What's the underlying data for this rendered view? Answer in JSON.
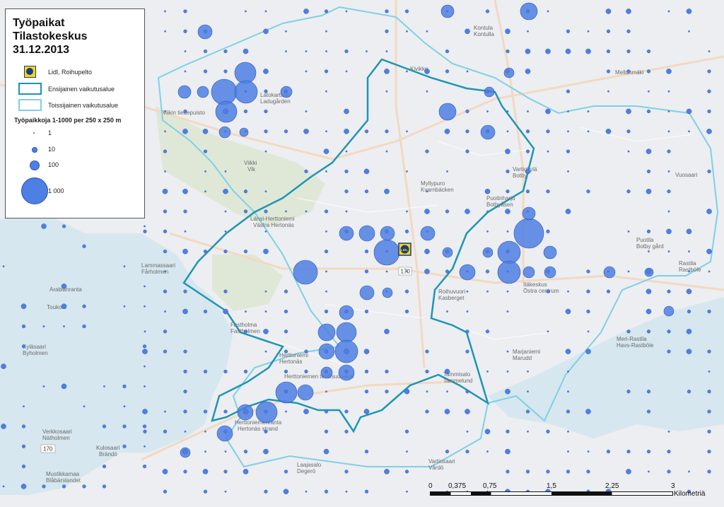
{
  "legend": {
    "title": "Työpaikat\nTilastokeskus\n31.12.2013",
    "store_label": "Lidl, Roihupelto",
    "primary_area_label": "Ensijainen vaikutusalue",
    "secondary_area_label": "Toissijainen vaikutusalue",
    "size_heading": "Työpaikkoja 1-1000 per 250 x 250 m",
    "size_classes": [
      "1",
      "10",
      "100",
      "1 000"
    ],
    "store_icon_text": "LIDL"
  },
  "scale_bar": {
    "ticks": [
      "0",
      "0,375",
      "0,75",
      "1,5",
      "2,25",
      "3"
    ],
    "unit": "Kilometriä"
  },
  "place_names": [
    "Kontula",
    "Kontulla",
    "Kivikko",
    "Mellunmäki",
    "Myllypuro",
    "Kvarnbäcken",
    "Latokartano",
    "Ladugården",
    "Viikki",
    "Vik",
    "Viikin tiedepuisto",
    "Länsi-Herttoniemi",
    "Västra Hertonäs",
    "Puotinharju",
    "Botbyåsen",
    "Puotila",
    "Botby gård",
    "Rastila",
    "Rastböle",
    "Vuosaari",
    "Itäkeskus",
    "Östra centrum",
    "Roihuvuori",
    "Kasberget",
    "Fastholma",
    "Fastholmen",
    "Herttoniemi",
    "Hertonäs",
    "Herttoniemen teollisuusalue",
    "Herttoniemenranta",
    "Hertonäs strand",
    "Marjaniemi",
    "Marudd",
    "Tammisalo",
    "Tammelund",
    "Meri-Rastila",
    "Havs-Rastböle",
    "Laajasalo",
    "Degerö",
    "Kulosaari",
    "Brändö",
    "Verkkosaari",
    "Nätholmen",
    "Kyläsaari",
    "Byholmen",
    "Arabianranta",
    "Toukola",
    "Vartiosaari",
    "Vårdö",
    "Mustikkamaa",
    "Blåbärslandet",
    "Lammassaari",
    "Fårholmen",
    "Vartiokylä",
    "Botby",
    "Myllypuro"
  ],
  "road_numbers": [
    "170",
    "170"
  ],
  "colors": {
    "dot_fill": "#4e7fe3",
    "dot_stroke": "#2c55b8",
    "primary_area": "#1b93b8",
    "secondary_area": "#7fd0e6",
    "water": "#d4e6ee",
    "store": "#f5d90a"
  },
  "icons": [
    "lidl-store-icon",
    "primary-area-swatch-icon",
    "secondary-area-swatch-icon"
  ]
}
